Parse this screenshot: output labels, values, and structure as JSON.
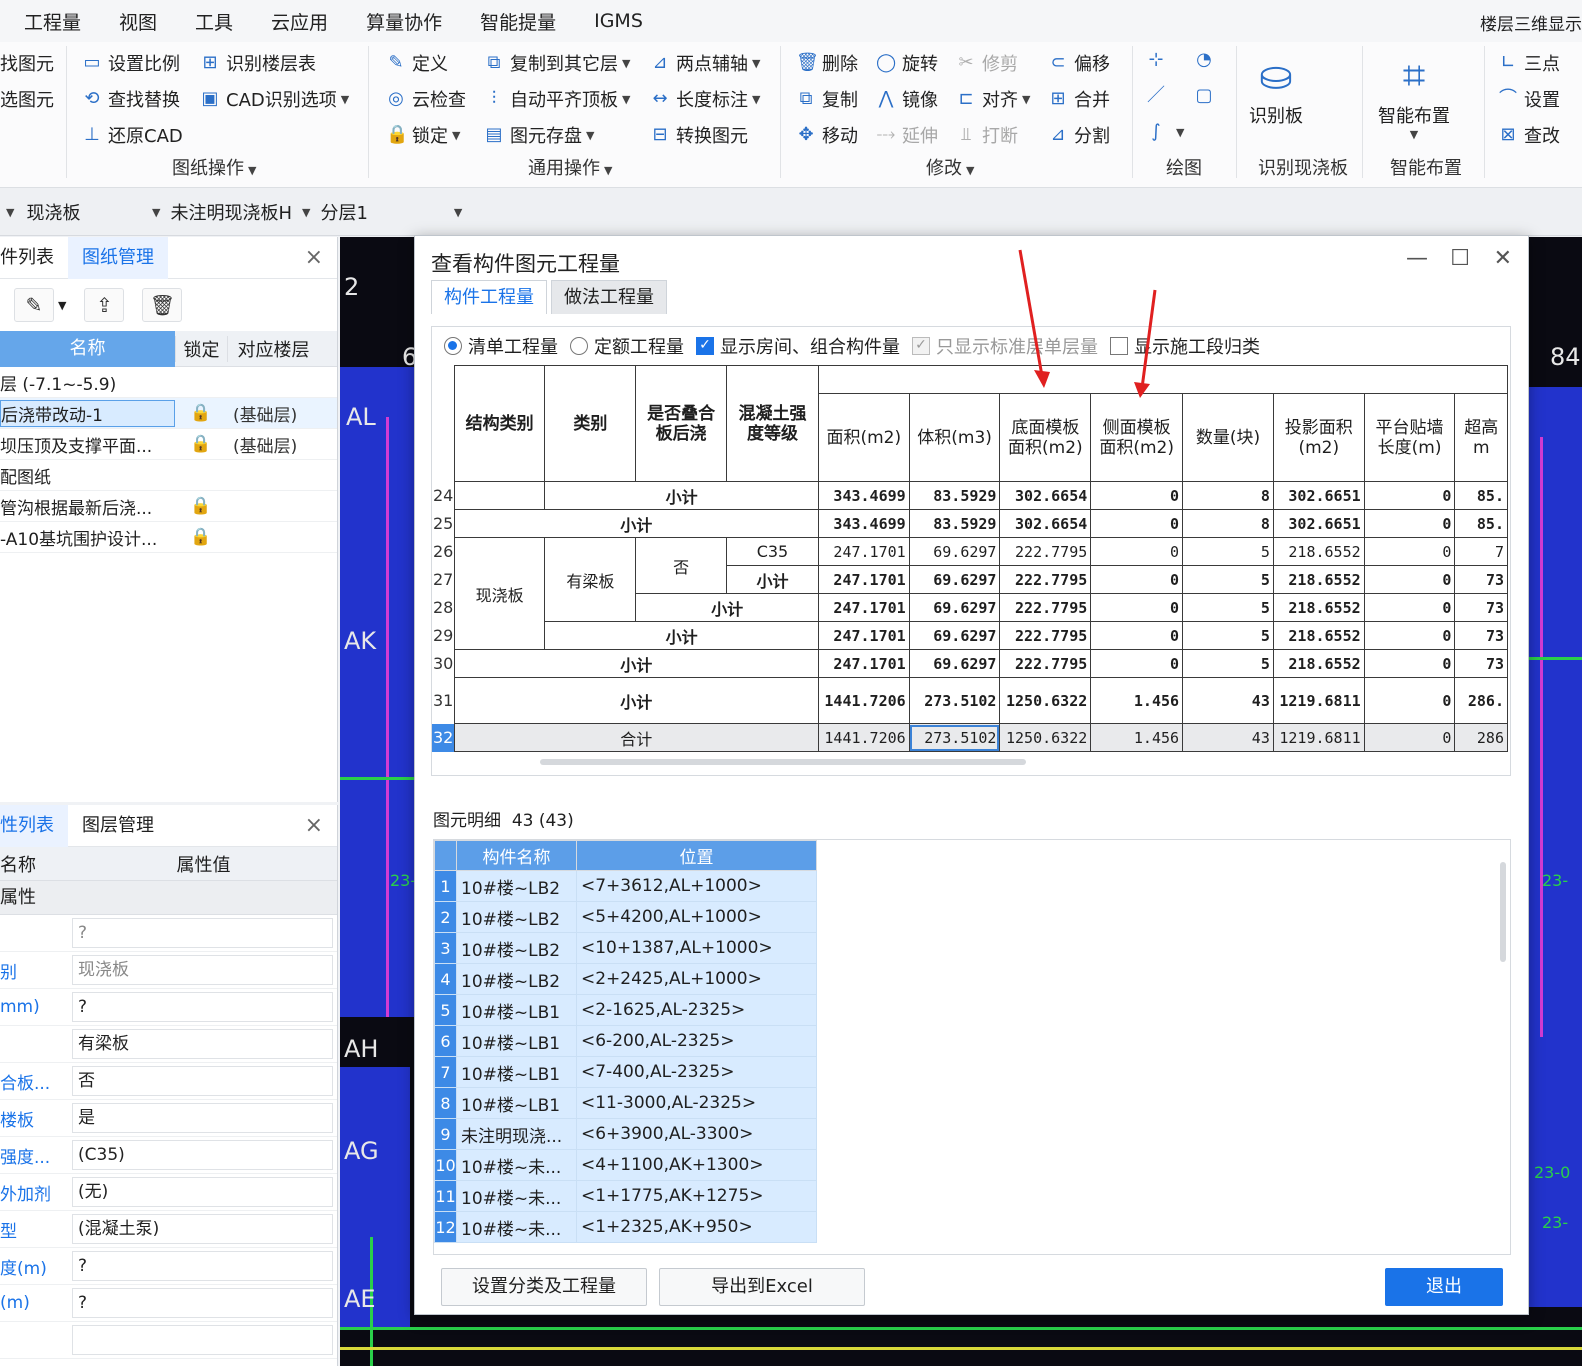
{
  "menu": {
    "items": [
      "工程量",
      "视图",
      "工具",
      "云应用",
      "算量协作",
      "智能提量",
      "IGMS"
    ],
    "right_title": "楼层三维显示"
  },
  "ribbon": {
    "col0": [
      "找图元",
      "选图元"
    ],
    "drawing_ops": {
      "set_scale": "设置比例",
      "find_replace": "查找替换",
      "restore_cad": "还原CAD",
      "identify_floor_table": "识别楼层表",
      "cad_options": "CAD识别选项",
      "group_label": "图纸操作"
    },
    "general_ops": {
      "define": "定义",
      "cloud_check": "云检查",
      "lock": "锁定",
      "copy_to_other_floor": "复制到其它层",
      "auto_flat_top": "自动平齐顶板",
      "element_storage": "图元存盘",
      "two_point_aux": "两点辅轴",
      "length_mark": "长度标注",
      "convert_element": "转换图元",
      "group_label": "通用操作"
    },
    "modify": {
      "delete": "删除",
      "copy": "复制",
      "move": "移动",
      "rotate": "旋转",
      "mirror": "镜像",
      "extend": "延伸",
      "trim": "修剪",
      "align": "对齐",
      "break": "打断",
      "offset": "偏移",
      "merge": "合并",
      "split": "分割",
      "group_label": "修改"
    },
    "draw": {
      "group_label": "绘图"
    },
    "identify_slab": {
      "button": "识别板",
      "group_label": "识别现浇板"
    },
    "smart_layout": {
      "button": "智能布置",
      "group_label": "智能布置"
    },
    "right_col": [
      "三点",
      "设置",
      "查改"
    ]
  },
  "selector_bar": {
    "component_type": "现浇板",
    "component_name": "未注明现浇板H",
    "layer": "分层1"
  },
  "drawing_panel": {
    "tabs": [
      "件列表",
      "图纸管理"
    ],
    "active_tab": "图纸管理",
    "columns": [
      "名称",
      "锁定",
      "对应楼层"
    ],
    "rows": [
      {
        "name": "层 (-7.1~-5.9)",
        "lock": "",
        "floor": ""
      },
      {
        "name": "后浇带改动-1",
        "lock": "🔒",
        "floor": "(基础层)"
      },
      {
        "name": "坝压顶及支撑平面...",
        "lock": "🔒",
        "floor": "(基础层)"
      },
      {
        "name": "配图纸",
        "lock": "",
        "floor": ""
      },
      {
        "name": "管沟根据最新后浇...",
        "lock": "🔒",
        "floor": ""
      },
      {
        "name": "-A10基坑围护设计...",
        "lock": "🔒",
        "floor": ""
      }
    ]
  },
  "property_panel": {
    "tabs": [
      "性列表",
      "图层管理"
    ],
    "columns": [
      "名称",
      "属性值"
    ],
    "group": "属性",
    "rows": [
      {
        "key": "",
        "value": "?",
        "grey": true
      },
      {
        "key": "别",
        "value": "现浇板",
        "grey": true
      },
      {
        "key": "mm)",
        "value": "?",
        "grey": false
      },
      {
        "key": "",
        "value": "有梁板",
        "grey": false
      },
      {
        "key": "合板...",
        "value": "否",
        "grey": false
      },
      {
        "key": "楼板",
        "value": "是",
        "grey": false
      },
      {
        "key": "强度...",
        "value": "(C35)",
        "grey": false
      },
      {
        "key": "外加剂",
        "value": "(无)",
        "grey": false
      },
      {
        "key": "型",
        "value": "(混凝土泵)",
        "grey": false
      },
      {
        "key": "度(m)",
        "value": "?",
        "grey": false
      },
      {
        "key": "(m)",
        "value": "?",
        "grey": false
      },
      {
        "key": "",
        "value": "",
        "grey": false
      }
    ]
  },
  "canvas": {
    "axis_labels": [
      "2",
      "6",
      "AL",
      "AK",
      "AH",
      "AG",
      "AE",
      "84"
    ],
    "dim_texts": [
      "23-",
      "23-",
      "23-0",
      "23-"
    ]
  },
  "dialog": {
    "title": "查看构件图元工程量",
    "tabs": [
      "构件工程量",
      "做法工程量"
    ],
    "active_tab": "构件工程量",
    "options": [
      {
        "label": "清单工程量",
        "type": "radio",
        "checked": true,
        "disabled": false
      },
      {
        "label": "定额工程量",
        "type": "radio",
        "checked": false,
        "disabled": false
      },
      {
        "label": "显示房间、组合构件量",
        "type": "check",
        "checked": true,
        "disabled": false
      },
      {
        "label": "只显示标准层单层量",
        "type": "check",
        "checked": true,
        "disabled": true
      },
      {
        "label": "显示施工段归类",
        "type": "check",
        "checked": false,
        "disabled": false
      }
    ],
    "table": {
      "headers": [
        "结构类别",
        "类别",
        "是否叠合板后浇",
        "混凝土强度等级",
        "面积(m2)",
        "体积(m3)",
        "底面模板面积(m2)",
        "侧面模板面积(m2)",
        "数量(块)",
        "投影面积(m2)",
        "平台贴墙长度(m)",
        "超高m"
      ],
      "subtotal": "小计",
      "total": "合计",
      "cat_structure": "现浇板",
      "cat_type": "有梁板",
      "cat_composite": "否",
      "cat_grade": "C35",
      "rows": [
        {
          "n": "24",
          "area": "343.4699",
          "vol": "83.5929",
          "bottom": "302.6654",
          "side": "0",
          "qty": "8",
          "proj": "302.6651",
          "wall": "0",
          "over": "85."
        },
        {
          "n": "25",
          "area": "343.4699",
          "vol": "83.5929",
          "bottom": "302.6654",
          "side": "0",
          "qty": "8",
          "proj": "302.6651",
          "wall": "0",
          "over": "85."
        },
        {
          "n": "26",
          "area": "247.1701",
          "vol": "69.6297",
          "bottom": "222.7795",
          "side": "0",
          "qty": "5",
          "proj": "218.6552",
          "wall": "0",
          "over": "7"
        },
        {
          "n": "27",
          "area": "247.1701",
          "vol": "69.6297",
          "bottom": "222.7795",
          "side": "0",
          "qty": "5",
          "proj": "218.6552",
          "wall": "0",
          "over": "73"
        },
        {
          "n": "28",
          "area": "247.1701",
          "vol": "69.6297",
          "bottom": "222.7795",
          "side": "0",
          "qty": "5",
          "proj": "218.6552",
          "wall": "0",
          "over": "73"
        },
        {
          "n": "29",
          "area": "247.1701",
          "vol": "69.6297",
          "bottom": "222.7795",
          "side": "0",
          "qty": "5",
          "proj": "218.6552",
          "wall": "0",
          "over": "73"
        },
        {
          "n": "30",
          "area": "247.1701",
          "vol": "69.6297",
          "bottom": "222.7795",
          "side": "0",
          "qty": "5",
          "proj": "218.6552",
          "wall": "0",
          "over": "73"
        },
        {
          "n": "31",
          "area": "1441.7206",
          "vol": "273.5102",
          "bottom": "1250.6322",
          "side": "1.456",
          "qty": "43",
          "proj": "1219.6811",
          "wall": "0",
          "over": "286."
        },
        {
          "n": "32",
          "area": "1441.7206",
          "vol": "273.5102",
          "bottom": "1250.6322",
          "side": "1.456",
          "qty": "43",
          "proj": "1219.6811",
          "wall": "0",
          "over": "286"
        }
      ]
    },
    "detail_label": "图元明细",
    "detail_count": "43 (43)",
    "detail_columns": [
      "构件名称",
      "位置"
    ],
    "detail_rows": [
      {
        "n": "1",
        "name": "10#楼~LB2",
        "pos": "<7+3612,AL+1000>"
      },
      {
        "n": "2",
        "name": "10#楼~LB2",
        "pos": "<5+4200,AL+1000>"
      },
      {
        "n": "3",
        "name": "10#楼~LB2",
        "pos": "<10+1387,AL+1000>"
      },
      {
        "n": "4",
        "name": "10#楼~LB2",
        "pos": "<2+2425,AL+1000>"
      },
      {
        "n": "5",
        "name": "10#楼~LB1",
        "pos": "<2-1625,AL-2325>"
      },
      {
        "n": "6",
        "name": "10#楼~LB1",
        "pos": "<6-200,AL-2325>"
      },
      {
        "n": "7",
        "name": "10#楼~LB1",
        "pos": "<7-400,AL-2325>"
      },
      {
        "n": "8",
        "name": "10#楼~LB1",
        "pos": "<11-3000,AL-2325>"
      },
      {
        "n": "9",
        "name": "未注明现浇...",
        "pos": "<6+3900,AL-3300>"
      },
      {
        "n": "10",
        "name": "10#楼~未...",
        "pos": "<4+1100,AK+1300>"
      },
      {
        "n": "11",
        "name": "10#楼~未...",
        "pos": "<1+1775,AK+1275>"
      },
      {
        "n": "12",
        "name": "10#楼~未...",
        "pos": "<1+2325,AK+950>"
      }
    ],
    "buttons": {
      "set_category": "设置分类及工程量",
      "export_excel": "导出到Excel",
      "exit": "退出"
    }
  },
  "colors": {
    "accent": "#1a73e8",
    "arrow": "#e02020",
    "canvas_bg": "#0a0a12",
    "slab_blue": "#2233cc"
  }
}
